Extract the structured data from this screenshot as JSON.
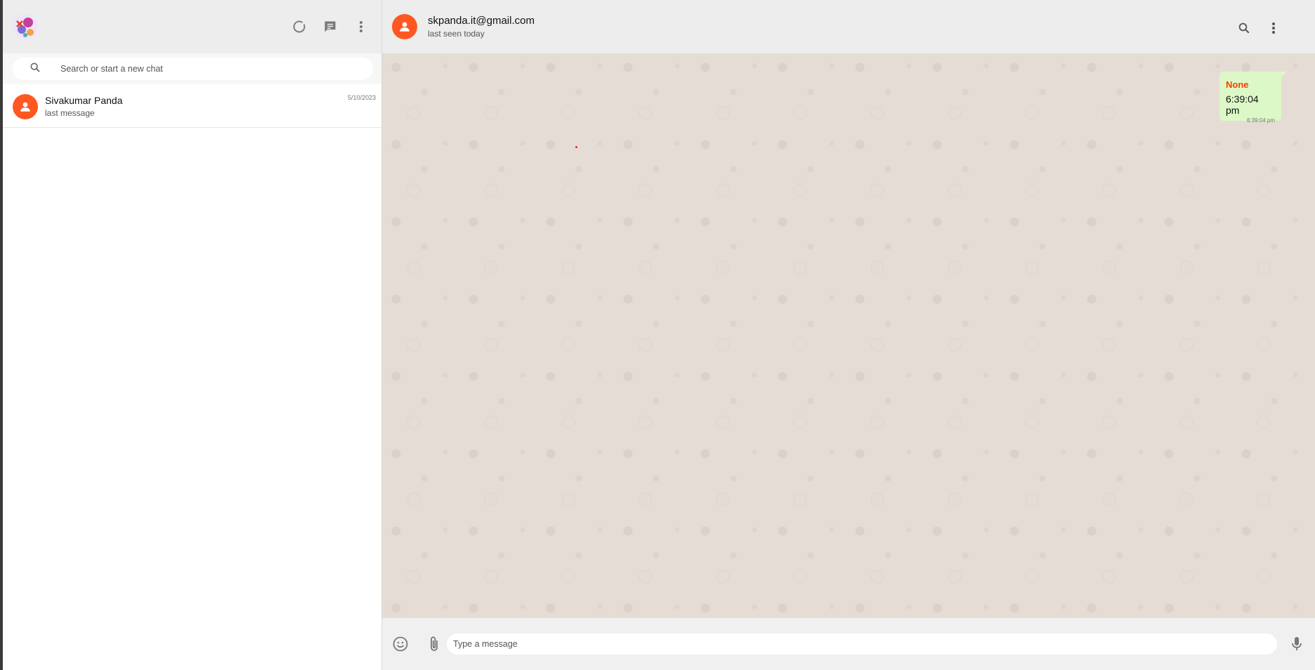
{
  "sidebar": {
    "icons": [
      "status-icon",
      "new-chat-icon",
      "menu-dots-icon"
    ],
    "search": {
      "placeholder": "Search or start a new chat",
      "value": ""
    },
    "chats": [
      {
        "name": "Sivakumar Panda",
        "last_message": "last message",
        "date": "5/10/2023"
      }
    ]
  },
  "main": {
    "header": {
      "title": "skpanda.it@gmail.com",
      "status": "last seen today"
    },
    "icons": [
      "search-icon",
      "menu-dots-icon"
    ],
    "messages": [
      {
        "sender": "None",
        "text": "6:39:04 pm",
        "time": "6:39:04 pm",
        "outgoing": true
      }
    ],
    "composer": {
      "placeholder": "Type a message",
      "value": ""
    }
  },
  "colors": {
    "accent": "#ff5722",
    "sender_name": "#ff3d00",
    "bubble_out": "#dcf8c6",
    "chat_background": "#e5ddd5",
    "header_bg": "#ededed"
  }
}
